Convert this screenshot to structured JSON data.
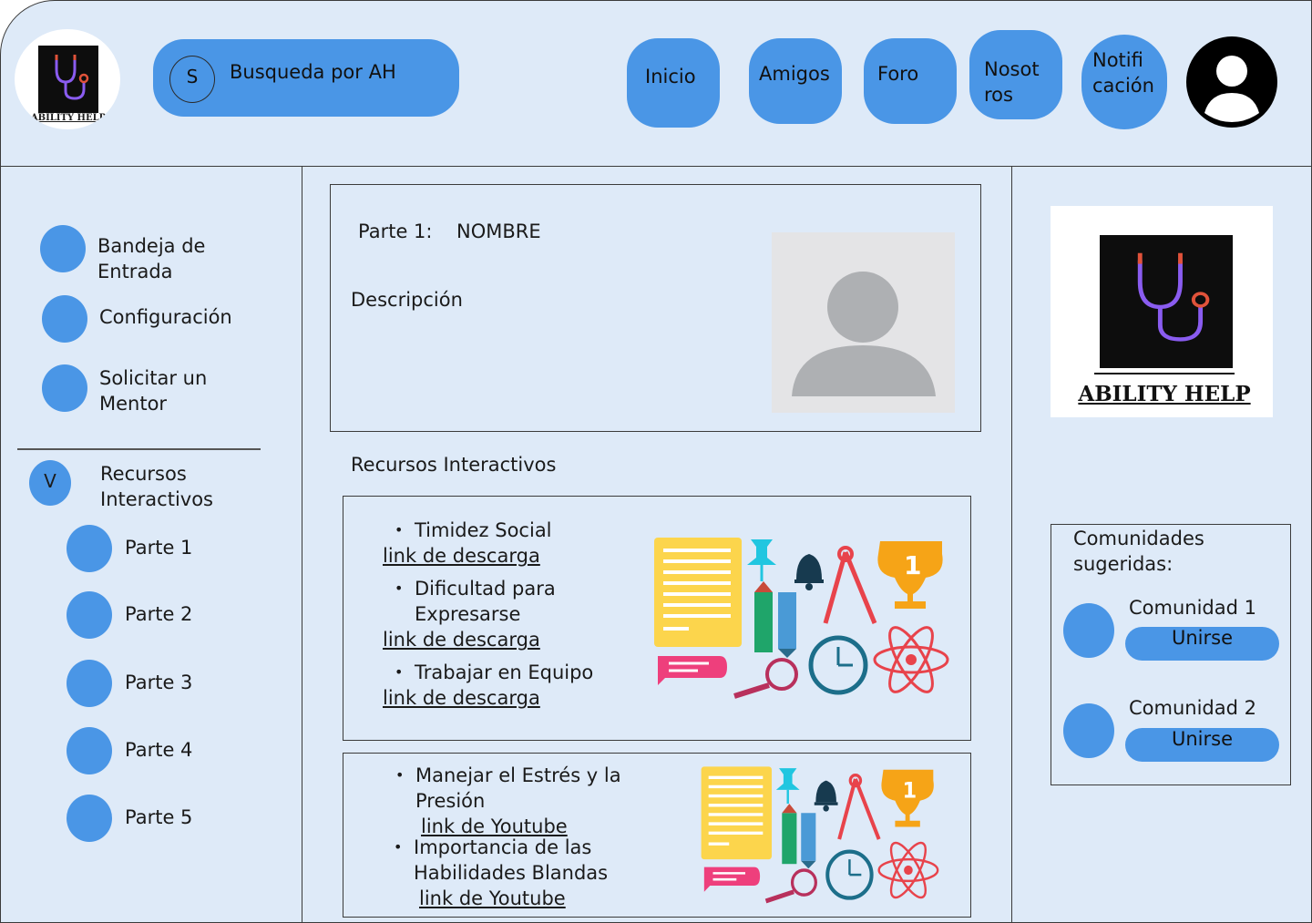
{
  "header": {
    "logo_text": "ABILITY HELP",
    "search": {
      "icon_letter": "S",
      "placeholder": "Busqueda por AH"
    },
    "nav": {
      "inicio": "Inicio",
      "amigos": "Amigos",
      "foro": "Foro",
      "nosotros_1": "Nosot",
      "nosotros_2": "ros",
      "notif_1": "Notifi",
      "notif_2": "cación"
    }
  },
  "sidebar": {
    "bandeja_1": "Bandeja de",
    "bandeja_2": "Entrada",
    "configuracion": "Configuración",
    "mentor_1": "Solicitar un",
    "mentor_2": "Mentor",
    "recursos_icon": "V",
    "recursos_1": "Recursos",
    "recursos_2": "Interactivos",
    "parts": [
      "Parte 1",
      "Parte 2",
      "Parte 3",
      "Parte 4",
      "Parte 5"
    ]
  },
  "main": {
    "part_label": "Parte 1:",
    "name": "NOMBRE",
    "description": "Descripción",
    "section_title": "Recursos Interactivos",
    "card1": {
      "item1": "Timidez Social",
      "link1": "link de descarga",
      "item2_1": "Dificultad para",
      "item2_2": "Expresarse",
      "link2": "link de descarga",
      "item3": "Trabajar en Equipo",
      "link3": "link de descarga"
    },
    "card2": {
      "item1_1": "Manejar el Estrés y la",
      "item1_2": "Presión",
      "link1": "link de Youtube",
      "item2_1": "Importancia de las",
      "item2_2": "Habilidades Blandas",
      "link2": "link de Youtube"
    }
  },
  "right": {
    "logo_text": "ABILITY HELP",
    "communities_title_1": "Comunidades",
    "communities_title_2": "sugeridas:",
    "community1": "Comunidad 1",
    "community2": "Comunidad 2",
    "join_label": "Unirse"
  },
  "colors": {
    "accent": "#4a96e6",
    "panel": "#deeaf8",
    "logo_bg": "#0d0d0d"
  },
  "icons": [
    "stethoscope-icon",
    "user-avatar-icon",
    "education-icons"
  ]
}
